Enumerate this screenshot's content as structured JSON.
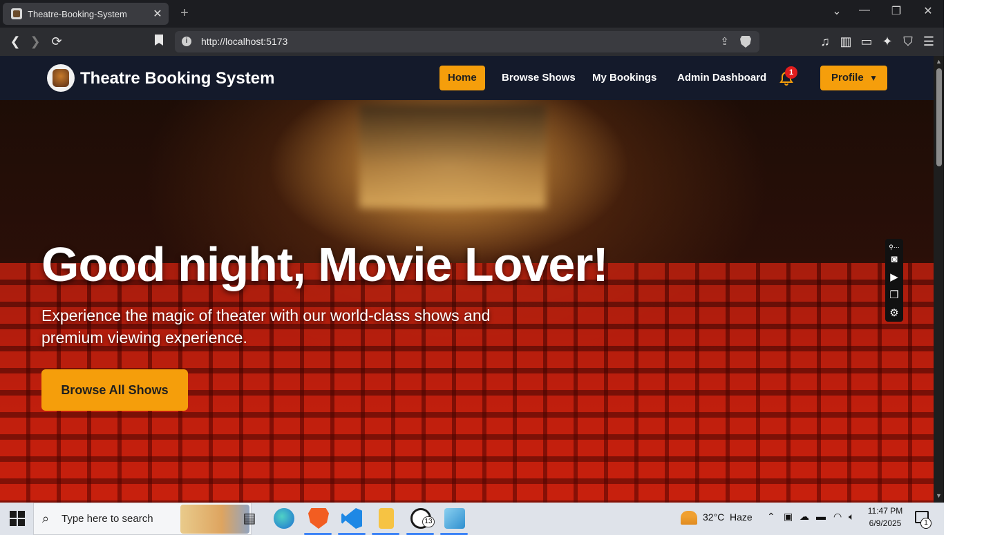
{
  "browser": {
    "tab_title": "Theatre-Booking-System",
    "tab_close": "✕",
    "new_tab": "+",
    "url": "http://localhost:5173"
  },
  "navbar": {
    "brand": "Theatre Booking System",
    "items": [
      {
        "label": "Home",
        "active": true
      },
      {
        "label": "Browse Shows",
        "active": false
      },
      {
        "label": "My Bookings",
        "active": false
      },
      {
        "label": "Admin Dashboard",
        "active": false
      }
    ],
    "notification_count": "1",
    "profile_label": "Profile",
    "accent_color": "#f59e0b",
    "bar_color": "#141a2b"
  },
  "hero": {
    "title": "Good night, Movie Lover!",
    "subtitle": "Experience the magic of theater with our world-class shows and premium viewing experience.",
    "cta_label": "Browse All Shows"
  },
  "taskbar": {
    "search_placeholder": "Type here to search",
    "weather_temp": "32°C",
    "weather_desc": "Haze",
    "time": "11:47 PM",
    "date": "6/9/2025",
    "whatsapp_badge": "13",
    "notification_badge": "1"
  }
}
